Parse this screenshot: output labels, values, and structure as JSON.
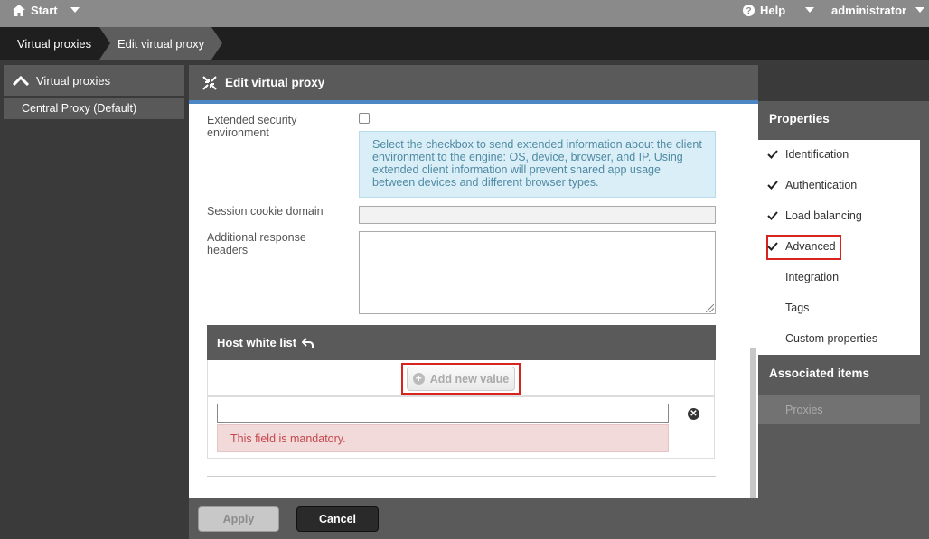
{
  "topbar": {
    "start_label": "Start",
    "help_label": "Help",
    "user_label": "administrator"
  },
  "breadcrumb": {
    "items": [
      {
        "label": "Virtual proxies"
      },
      {
        "label": "Edit virtual proxy"
      }
    ]
  },
  "left_panel": {
    "header": "Virtual proxies",
    "items": [
      {
        "label": "Central Proxy (Default)"
      }
    ]
  },
  "main": {
    "title": "Edit virtual proxy",
    "fields": {
      "extended_security_label": "Extended security environment",
      "extended_security_checked": false,
      "extended_security_info": "Select the checkbox to send extended information about the client environment to the engine: OS, device, browser, and IP. Using extended client information will prevent shared app usage between devices and different browser types.",
      "session_cookie_label": "Session cookie domain",
      "session_cookie_value": "",
      "additional_headers_label": "Additional response headers",
      "additional_headers_value": ""
    },
    "host_white_list": {
      "title": "Host white list",
      "add_button_label": "Add new value",
      "entry_value": "",
      "error_message": "This field is mandatory."
    }
  },
  "footer": {
    "apply_label": "Apply",
    "cancel_label": "Cancel"
  },
  "properties": {
    "title": "Properties",
    "items": [
      {
        "label": "Identification",
        "checked": true
      },
      {
        "label": "Authentication",
        "checked": true
      },
      {
        "label": "Load balancing",
        "checked": true
      },
      {
        "label": "Advanced",
        "checked": true,
        "highlighted": true
      },
      {
        "label": "Integration",
        "checked": false
      },
      {
        "label": "Tags",
        "checked": false
      },
      {
        "label": "Custom properties",
        "checked": false
      }
    ],
    "associated_title": "Associated items",
    "associated_items": [
      {
        "label": "Proxies"
      }
    ]
  },
  "colors": {
    "accent_blue": "#4c86c4",
    "highlight_red": "#d9231f",
    "error_bg": "#f2d9da",
    "error_text": "#c4474b",
    "info_bg": "#d9eef7"
  }
}
